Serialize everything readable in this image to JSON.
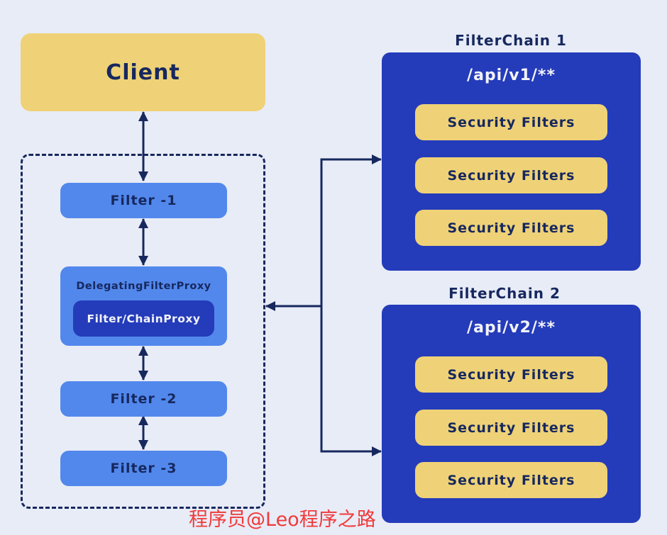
{
  "client": {
    "label": "Client"
  },
  "filters": {
    "filter1": "Filter -1",
    "delegating_proxy": "DelegatingFilterProxy",
    "filter_chain_proxy": "Filter/ChainProxy",
    "filter2": "Filter -2",
    "filter3": "Filter -3"
  },
  "chains": [
    {
      "title": "FilterChain 1",
      "path": "/api/v1/**",
      "items": [
        "Security Filters",
        "Security Filters",
        "Security Filters"
      ]
    },
    {
      "title": "FilterChain 2",
      "path": "/api/v2/**",
      "items": [
        "Security Filters",
        "Security Filters",
        "Security Filters"
      ]
    }
  ],
  "watermark": "程序员@Leo程序之路",
  "colors": {
    "background": "#e8ecf7",
    "client_yellow": "#efd277",
    "filter_blue": "#5288ec",
    "chain_blue": "#243cba",
    "navy": "#17285e",
    "watermark_red": "#f03a3a"
  }
}
